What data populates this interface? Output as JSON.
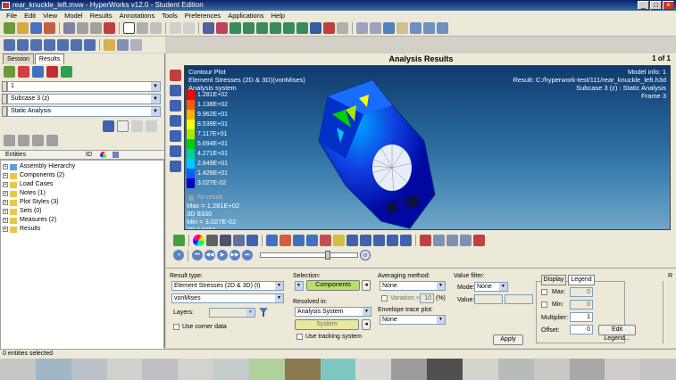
{
  "window": {
    "title": "rear_knuckle_left.mvw - HyperWorks v12.0 - Student Edition"
  },
  "menu": [
    "File",
    "Edit",
    "View",
    "Model",
    "Results",
    "Annotations",
    "Tools",
    "Preferences",
    "Applications",
    "Help"
  ],
  "left": {
    "tabs": [
      "Session",
      "Results"
    ],
    "page_select": "1",
    "subcase_select": "Subcase 3 (z)",
    "analysis_select": "Static Analysis",
    "entities_label": "Entities",
    "id_label": "ID",
    "tree": [
      {
        "label": "Assembly Hierarchy",
        "color": "#5aa0d8"
      },
      {
        "label": "Components (2)",
        "color": "#e8c84a"
      },
      {
        "label": "Load Cases",
        "color": "#e8c84a"
      },
      {
        "label": "Notes (1)",
        "color": "#e8c84a"
      },
      {
        "label": "Plot Styles (3)",
        "color": "#e8c84a"
      },
      {
        "label": "Sets (0)",
        "color": "#e8c84a"
      },
      {
        "label": "Measures (2)",
        "color": "#e8c84a"
      },
      {
        "label": "Results",
        "color": "#e8c84a"
      }
    ]
  },
  "viewport": {
    "title": "Analysis Results",
    "page": "1 of 1",
    "contour_lines": [
      "Contour Plot",
      "Element Stresses (2D & 3D)(vonMises)",
      "Analysis system"
    ],
    "model_info": "Model info: 1",
    "result_path": "Result: C:/hyperwork-test/111/rear_knuckle_left.h3d",
    "subcase_info": "Subcase 3 (z) : Static Analysis",
    "frame_info": "Frame 3",
    "legend": [
      {
        "value": "1.281E+02",
        "color": "#ff0000"
      },
      {
        "value": "1.138E+02",
        "color": "#ff5a00"
      },
      {
        "value": "9.962E+01",
        "color": "#ffb000"
      },
      {
        "value": "8.539E+01",
        "color": "#ffff00"
      },
      {
        "value": "7.117E+01",
        "color": "#a8e800"
      },
      {
        "value": "5.694E+01",
        "color": "#00d000"
      },
      {
        "value": "4.271E+01",
        "color": "#00d0a0"
      },
      {
        "value": "2.849E+01",
        "color": "#00c8ff"
      },
      {
        "value": "1.426E+01",
        "color": "#0060ff"
      },
      {
        "value": "3.027E-02",
        "color": "#0000c8"
      }
    ],
    "no_result": "No result",
    "max_line": "Max = 1.281E+02",
    "max_id": "3D 8330",
    "min_line": "Min = 3.027E-02",
    "min_id": "3D 14063"
  },
  "panel": {
    "result_type_label": "Result type:",
    "result_type_value": "Element Stresses (2D & 3D) (t)",
    "component_value": "vonMises",
    "layers_label": "Layers:",
    "use_corner_data": "Use corner data",
    "selection_label": "Selection:",
    "selection_button": "Components",
    "resolved_label": "Resolved in:",
    "resolved_value": "Analysis System",
    "system_button": "System",
    "use_tracking": "Use tracking system",
    "averaging_label": "Averaging method:",
    "averaging_value": "None",
    "variation_label": "Variation <",
    "variation_value": "10",
    "variation_unit": "(%)",
    "envelope_label": "Envelope trace plot:",
    "envelope_value": "None",
    "value_filter_label": "Value filter:",
    "mode_label": "Mode:",
    "mode_value": "None",
    "value_label": "Value:",
    "apply_button": "Apply",
    "display_tab": "Display",
    "legend_tab": "Legend",
    "max_label": "Max:",
    "max_value": "0",
    "min_label": "Min:",
    "min_value": "0",
    "multiplier_label": "Multiplier:",
    "multiplier_value": "1",
    "offset_label": "Offset:",
    "offset_value": "0",
    "edit_legend_button": "Edit Legend...",
    "side_label": "R"
  },
  "status": {
    "text": "0 entities selected"
  },
  "palette": [
    "#c8c6c4",
    "#9fb6c4",
    "#b8c2c8",
    "#d0d0cc",
    "#c0c0c4",
    "#d4d2ce",
    "#c4cccc",
    "#b0d09c",
    "#8a7a50",
    "#7ec8c4",
    "#d8d8d4",
    "#9c9c9c",
    "#505050",
    "#d4d4cc",
    "#b8bcb8",
    "#c8c8c4",
    "#a8a8a8",
    "#d0cccc",
    "#c4c4c4"
  ]
}
